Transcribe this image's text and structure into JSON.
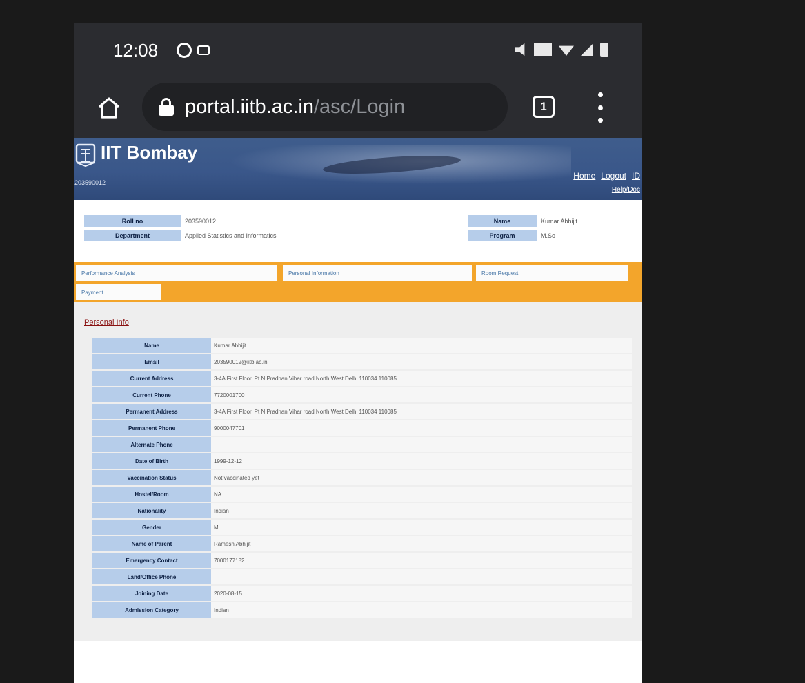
{
  "status_bar": {
    "time": "12:08"
  },
  "browser": {
    "url_domain": "portal.iitb.ac.in",
    "url_path": "/asc/Login",
    "tab_count": "1"
  },
  "header": {
    "title": "IIT Bombay",
    "roll_number": "203590012",
    "links": [
      "Home",
      "Logout",
      "ID"
    ],
    "help_link": "Help/Doc"
  },
  "info": {
    "rows": [
      {
        "label": "Roll no",
        "value": "203590012",
        "label2": "Name",
        "value2": "Kumar Abhijit"
      },
      {
        "label": "Department",
        "value": "Applied Statistics and Informatics",
        "label2": "Program",
        "value2": "M.Sc"
      }
    ]
  },
  "tabs": [
    "Performance Analysis",
    "Personal Information",
    "Room Request",
    "Payment"
  ],
  "personal_info": {
    "title": "Personal Info",
    "rows": [
      {
        "label": "Name",
        "value": "Kumar Abhijit"
      },
      {
        "label": "Email",
        "value": "203590012@iitb.ac.in"
      },
      {
        "label": "Current Address",
        "value": "3-4A First Floor, Pt N Pradhan Vihar road North West Delhi 110034 110085"
      },
      {
        "label": "Current Phone",
        "value": "7720001700"
      },
      {
        "label": "Permanent Address",
        "value": "3-4A First Floor, Pt N Pradhan Vihar road North West Delhi 110034 110085"
      },
      {
        "label": "Permanent Phone",
        "value": "9000047701"
      },
      {
        "label": "Alternate Phone",
        "value": ""
      },
      {
        "label": "Date of Birth",
        "value": "1999-12-12"
      },
      {
        "label": "Vaccination Status",
        "value": "Not vaccinated yet"
      },
      {
        "label": "Hostel/Room",
        "value": "NA"
      },
      {
        "label": "Nationality",
        "value": "Indian"
      },
      {
        "label": "Gender",
        "value": "M"
      },
      {
        "label": "Name of Parent",
        "value": "Ramesh Abhijit"
      },
      {
        "label": "Emergency Contact",
        "value": "7000177182"
      },
      {
        "label": "Land/Office Phone",
        "value": ""
      },
      {
        "label": "Joining Date",
        "value": "2020-08-15"
      },
      {
        "label": "Admission Category",
        "value": "Indian"
      }
    ]
  }
}
